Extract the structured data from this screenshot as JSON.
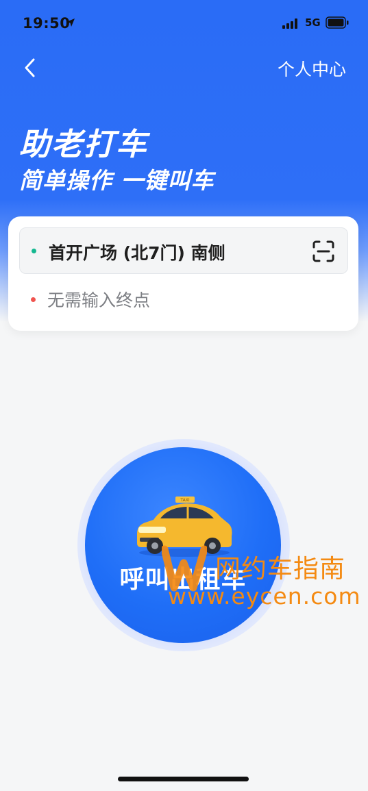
{
  "status_bar": {
    "time": "19:50",
    "network": "5G"
  },
  "nav": {
    "personal_center": "个人中心"
  },
  "header": {
    "title": "助老打车",
    "subtitle": "简单操作 一键叫车"
  },
  "route": {
    "origin": "首开广场 (北7门) 南侧",
    "destination_placeholder": "无需输入终点"
  },
  "call_button": {
    "label": "呼叫出租车",
    "taxi_sign": "TAXI"
  },
  "watermark": {
    "cn": "网约车指南",
    "url": "www.eycen.com"
  },
  "colors": {
    "primary": "#2a6cf6",
    "origin_dot": "#15b890",
    "dest_dot": "#f0544f",
    "watermark": "#f48a12"
  },
  "icons": [
    "location-arrow-icon",
    "signal-icon",
    "battery-icon",
    "back-chevron-icon",
    "scan-icon",
    "taxi-illustration"
  ]
}
